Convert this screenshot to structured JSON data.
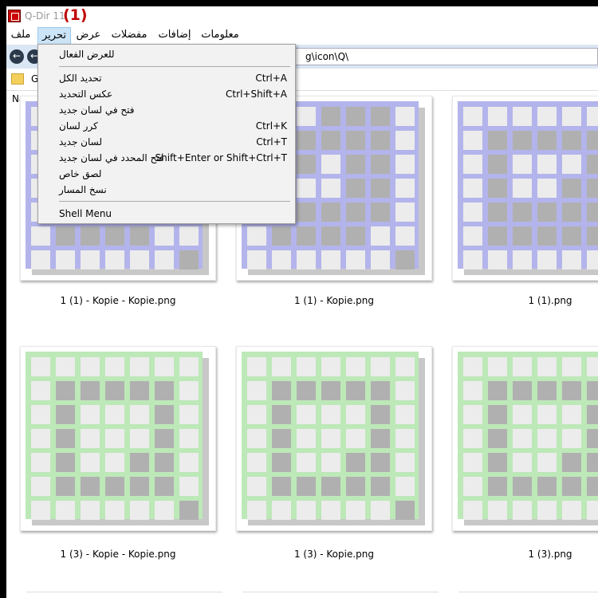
{
  "title": {
    "text": "Q-Dir 11.",
    "marker": "(1)"
  },
  "menubar": {
    "items": [
      {
        "label": "ملف",
        "active": false
      },
      {
        "label": "تحرير",
        "active": true
      },
      {
        "label": "عرض",
        "active": false
      },
      {
        "label": "مفضلات",
        "active": false
      },
      {
        "label": "إضافات",
        "active": false
      },
      {
        "label": "معلومات",
        "active": false
      }
    ]
  },
  "toolbar": {
    "address": "g\\icon\\Q\\"
  },
  "tabs": {
    "first_tab_partial": "G"
  },
  "columns": {
    "name": "Name"
  },
  "dropdown": {
    "items": [
      {
        "label": "للعرض الفعال",
        "shortcut": ""
      },
      {
        "label": "تحديد الكل",
        "shortcut": "Ctrl+A"
      },
      {
        "label": "عكس التحديد",
        "shortcut": "Ctrl+Shift+A"
      },
      {
        "label": "فتح في لسان جديد",
        "shortcut": ""
      },
      {
        "label": "كرر لسان",
        "shortcut": "Ctrl+K"
      },
      {
        "label": "لسان جديد",
        "shortcut": "Ctrl+T"
      },
      {
        "label": "فتح المحدد في لسان جديد",
        "shortcut": "Shift+Enter or Shift+Ctrl+T"
      },
      {
        "label": "لصق خاص",
        "shortcut": ""
      },
      {
        "label": "نسخ المسار",
        "shortcut": ""
      },
      {
        "label": "Shell Menu",
        "shortcut": ""
      }
    ]
  },
  "files": [
    {
      "name": "1 (1) - Kopie - Kopie.png",
      "theme": "purple"
    },
    {
      "name": "1 (1) - Kopie.png",
      "theme": "purple"
    },
    {
      "name": "1 (1).png",
      "theme": "purple"
    },
    {
      "name": "1 (3) - Kopie - Kopie.png",
      "theme": "green"
    },
    {
      "name": "1 (3) - Kopie.png",
      "theme": "green"
    },
    {
      "name": "1 (3).png",
      "theme": "green"
    }
  ],
  "colors": {
    "purple_frame": "#b4b4ec",
    "green_frame": "#bde8b8",
    "cell_light": "#ececec",
    "cell_dark": "#b0b0b0",
    "marker_red": "#c00000",
    "menu_highlight": "#cce4f7",
    "toolbar_bg": "#dbe6f4"
  },
  "icons": {
    "app": "qdir-app-icon",
    "back": "arrow-left-icon",
    "forward": "arrow-right-icon",
    "folder": "folder-icon"
  }
}
